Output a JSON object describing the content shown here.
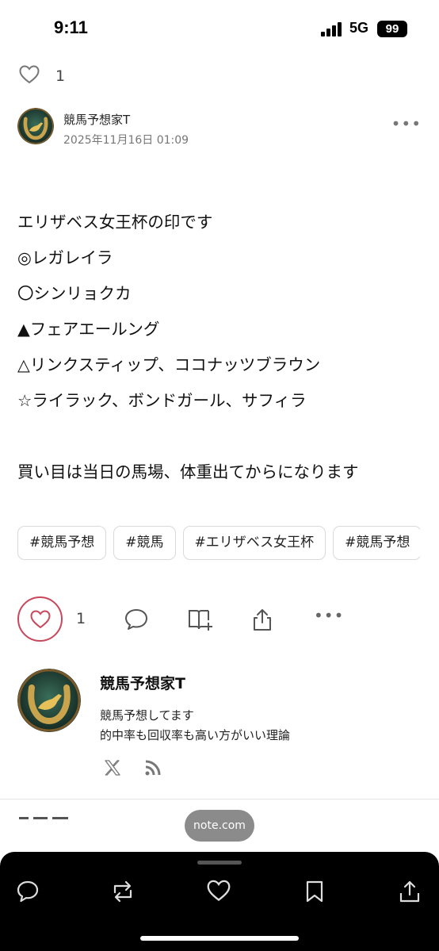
{
  "status_bar": {
    "time": "9:11",
    "network": "5G",
    "battery": "99"
  },
  "top_like": {
    "count": "1",
    "icon": "heart-outline-icon"
  },
  "author": {
    "name": "競馬予想家T",
    "date": "2025年11月16日 01:09",
    "more": "•••"
  },
  "article": {
    "lines": [
      "エリザベス女王杯の印です",
      "◎レガレイラ",
      "〇シンリョクカ",
      "▲フェアエールング",
      "△リンクスティップ、ココナッツブラウン",
      "☆ライラック、ボンドガール、サフィラ",
      "",
      "買い目は当日の馬場、体重出てからになります"
    ]
  },
  "tags": [
    "#競馬予想",
    "#競馬",
    "#エリザベス女王杯",
    "#競馬予想"
  ],
  "actions": {
    "like_count": "1",
    "icons": [
      "heart-icon",
      "comment-icon",
      "magazine-add-icon",
      "share-icon",
      "more-icon"
    ],
    "more": "•••",
    "like_color": "#c8485c"
  },
  "author_card": {
    "name": "競馬予想家T",
    "bio_line1": "競馬予想してます",
    "bio_line2": "的中率も回収率も高い方がいい理論",
    "social": [
      "x-icon",
      "rss-icon"
    ]
  },
  "url_pill": "note.com",
  "bottom_bar": {
    "icons": [
      "reply-icon",
      "repost-icon",
      "like-icon",
      "bookmark-icon",
      "share-icon"
    ]
  }
}
